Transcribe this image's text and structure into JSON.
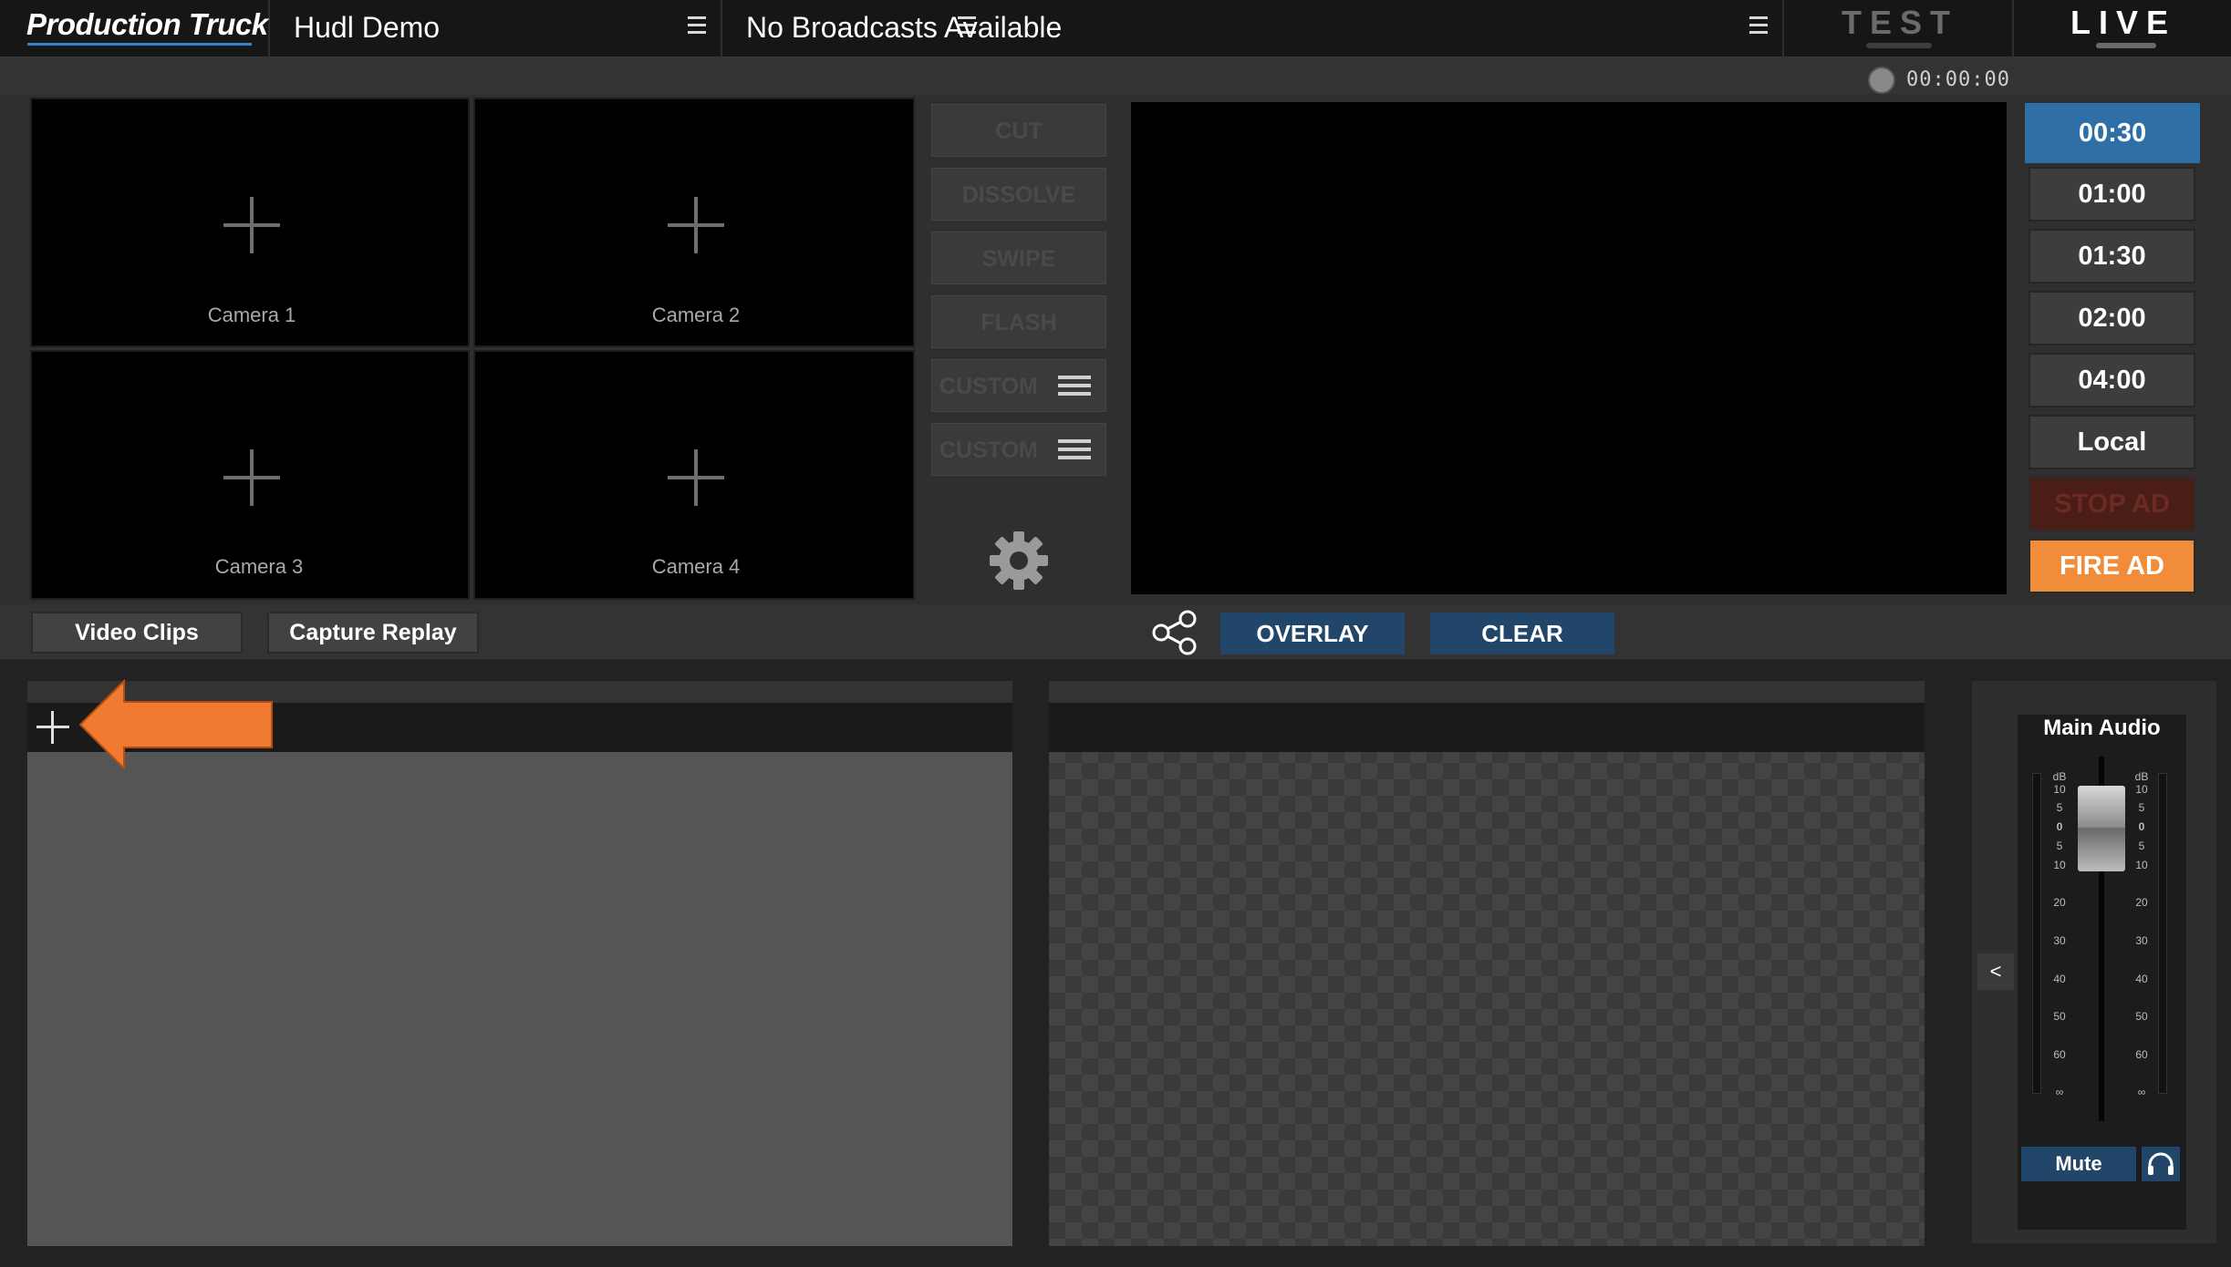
{
  "header": {
    "brand": "Production Truck",
    "project": "Hudl Demo",
    "broadcast": "No Broadcasts Available",
    "mode_test": "TEST",
    "mode_live": "LIVE",
    "timecode": "00:00:00"
  },
  "cameras": [
    {
      "label": "Camera 1"
    },
    {
      "label": "Camera 2"
    },
    {
      "label": "Camera 3"
    },
    {
      "label": "Camera 4"
    }
  ],
  "transitions": [
    "CUT",
    "DISSOLVE",
    "SWIPE",
    "FLASH",
    "CUSTOM",
    "CUSTOM"
  ],
  "ad_durations": [
    "00:30",
    "01:00",
    "01:30",
    "02:00",
    "04:00",
    "Local"
  ],
  "ad_controls": {
    "stop": "STOP AD",
    "fire": "FIRE AD"
  },
  "tabs": {
    "video_clips": "Video Clips",
    "capture_replay": "Capture Replay"
  },
  "overlay": {
    "overlay_label": "OVERLAY",
    "clear_label": "CLEAR"
  },
  "audio": {
    "title": "Main Audio",
    "mute_label": "Mute",
    "collapse_label": "<",
    "scale_left": [
      "dB",
      "10",
      "5",
      "0",
      "5",
      "10",
      "20",
      "30",
      "40",
      "50",
      "60",
      "∞"
    ],
    "scale_right": [
      "dB",
      "10",
      "5",
      "0",
      "5",
      "10",
      "20",
      "30",
      "40",
      "50",
      "60",
      "∞"
    ]
  },
  "colors": {
    "accent_blue": "#2f6fa8",
    "overlay_blue": "#21466a",
    "fire_orange": "#f08c3a",
    "stop_red": "#4a1d17",
    "annotation_arrow": "#f07a30"
  }
}
